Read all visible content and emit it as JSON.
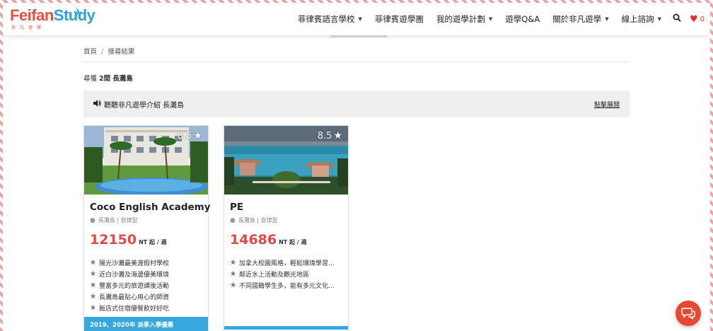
{
  "header": {
    "logo": {
      "main_part1": "Feifan",
      "main_part2": "Study",
      "subtitle": "非凡遊學"
    },
    "nav": [
      {
        "label": "菲律賓語言學校",
        "has_dropdown": true
      },
      {
        "label": "菲律賓遊學團",
        "has_dropdown": false
      },
      {
        "label": "我的遊學計劃",
        "has_dropdown": true
      },
      {
        "label": "遊學Q&A",
        "has_dropdown": false
      },
      {
        "label": "關於非凡遊學",
        "has_dropdown": true
      },
      {
        "label": "線上諮詢",
        "has_dropdown": true
      }
    ],
    "favorites_count": "0"
  },
  "breadcrumb": {
    "home": "首頁",
    "separator": "/",
    "current": "搜尋結果"
  },
  "results": {
    "prefix": "尋獲",
    "count": "2間",
    "location": "長灘島"
  },
  "intro": {
    "label": "聽聽非凡遊學介紹 長灘島",
    "expand": "點擊展開"
  },
  "cards": [
    {
      "rating": "8.5",
      "name": "Coco English Academy",
      "location": "長灘島 | 自律型",
      "price": "12150",
      "price_unit": "NT 起 / 週",
      "features": [
        "陽光沙灘最美渡假村學校",
        "近白沙灘及海邊優美環境",
        "豐富多元的旅遊課後活動",
        "長灘島最貼心用心的師資",
        "飯店式住宿優餐飲好好吃"
      ],
      "promo": "2019、2020年 淡季入學優惠"
    },
    {
      "rating": "8.5",
      "name": "PE",
      "location": "長灘島 | 自律型",
      "price": "14686",
      "price_unit": "NT 起 / 週",
      "features": [
        "加拿大校園風格，輕鬆環境學習...",
        "鄰近水上活動及觀光地區",
        "不同國籍學生多，能有多元文化..."
      ]
    }
  ],
  "colors": {
    "accent_red": "#e04848",
    "accent_blue": "#37a8df",
    "chat_orange": "#e64a2e"
  },
  "icons": [
    "search-icon",
    "heart-icon",
    "speaker-icon",
    "map-pin-icon",
    "star-icon",
    "chat-icon"
  ]
}
